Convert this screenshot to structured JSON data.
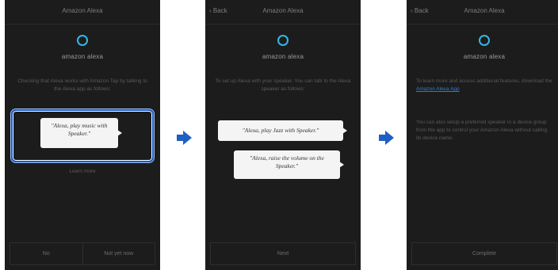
{
  "screens": [
    {
      "title": "Amazon Alexa",
      "logo_text": "amazon alexa",
      "description": "Checking that Alexa works with Amazon Tap by talking to the Alexa app as follows:",
      "bubbles": [
        "\"Alexa, play music with Speaker.\""
      ],
      "learn_link": "Learn more",
      "buttons": [
        "No",
        "Not yet now"
      ]
    },
    {
      "back": "Back",
      "title": "Amazon Alexa",
      "logo_text": "amazon alexa",
      "description": "To set up Alexa with your speaker. You can talk to the Alexa speaker as follows:",
      "bubbles": [
        "\"Alexa, play Jazz with Speaker.\"",
        "\"Alexa, raise the volume on the Speaker.\""
      ],
      "buttons": [
        "Next"
      ]
    },
    {
      "back": "Back",
      "title": "Amazon Alexa",
      "logo_text": "amazon alexa",
      "description_1": "To learn more and access additional features, download the",
      "description_link": "Amazon Alexa App",
      "description_2": "You can also setup a preferred speaker in a device group from the app to control your Amazon Alexa without calling its device name.",
      "buttons": [
        "Complete"
      ]
    }
  ],
  "colors": {
    "accent": "#1f5fc4",
    "alexa_ring": "#32b8e8",
    "screen_bg": "#1c1c1c"
  }
}
